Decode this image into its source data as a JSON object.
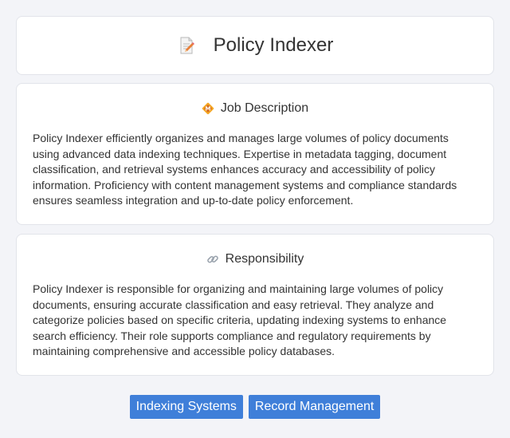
{
  "header": {
    "icon": "document-pencil-icon",
    "title": "Policy Indexer"
  },
  "sections": [
    {
      "icon": "badge-icon",
      "heading": "Job Description",
      "body": "Policy Indexer efficiently organizes and manages large volumes of policy documents using advanced data indexing techniques. Expertise in metadata tagging, document classification, and retrieval systems enhances accuracy and accessibility of policy information. Proficiency with content management systems and compliance standards ensures seamless integration and up-to-date policy enforcement."
    },
    {
      "icon": "link-icon",
      "heading": "Responsibility",
      "body": "Policy Indexer is responsible for organizing and maintaining large volumes of policy documents, ensuring accurate classification and easy retrieval. They analyze and categorize policies based on specific criteria, updating indexing systems to enhance search efficiency. Their role supports compliance and regulatory requirements by maintaining comprehensive and accessible policy databases."
    }
  ],
  "tags": [
    "Indexing Systems",
    "Record Management"
  ],
  "colors": {
    "background": "#f3f4f8",
    "card": "#ffffff",
    "tag": "#3f7fd9",
    "text": "#333333"
  }
}
